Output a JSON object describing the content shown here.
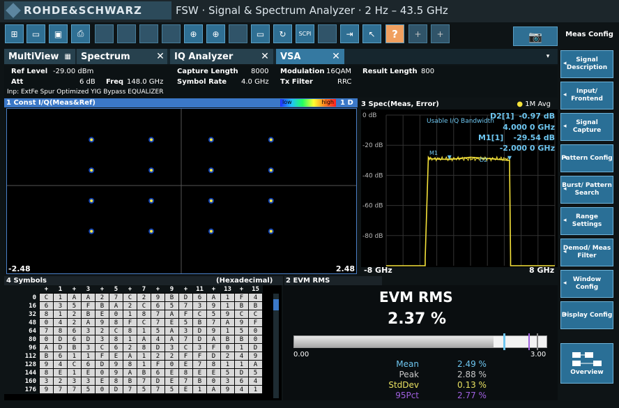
{
  "app": {
    "logo_text": "ROHDE&SCHWARZ",
    "title": "FSW · Signal & Spectrum Analyzer · 2 Hz – 43.5 GHz"
  },
  "toolbar": {
    "scpi_label": "SCPI",
    "help_label": "?",
    "camera_icon": "camera-icon"
  },
  "side_panel": {
    "header": "Meas Config",
    "buttons": [
      {
        "label": "Signal Description"
      },
      {
        "label": "Input/ Frontend"
      },
      {
        "label": "Signal Capture"
      },
      {
        "label": "Pattern Config"
      },
      {
        "label": "Burst/ Pattern Search"
      },
      {
        "label": "Range Settings"
      },
      {
        "label": "Demod/ Meas Filter"
      },
      {
        "label": "Window Config"
      },
      {
        "label": "Display Config"
      },
      {
        "label": "Overview"
      }
    ]
  },
  "tabs": [
    {
      "label": "MultiView"
    },
    {
      "label": "Spectrum"
    },
    {
      "label": "IQ Analyzer"
    },
    {
      "label": "VSA"
    }
  ],
  "info": {
    "ref_level_label": "Ref Level",
    "ref_level_value": "-29.00 dBm",
    "att_label": "Att",
    "att_value": "6 dB",
    "freq_label": "Freq",
    "freq_value": "148.0 GHz",
    "capture_length_label": "Capture Length",
    "capture_length_value": "8000",
    "symbol_rate_label": "Symbol Rate",
    "symbol_rate_value": "4.0 GHz",
    "modulation_label": "Modulation",
    "modulation_value": "16QAM",
    "tx_filter_label": "Tx Filter",
    "tx_filter_value": "RRC",
    "result_length_label": "Result Length",
    "result_length_value": "800",
    "inp_line": "Inp: ExtFe Spur Optimized YIG Bypass EQUALIZER"
  },
  "pane1": {
    "title": "1 Const I/Q(Meas&Ref)",
    "legend_low": "low",
    "legend_high": "high",
    "trace_tag": "1 D",
    "x_min_label": "-2.48",
    "x_max_label": "2.48"
  },
  "pane3": {
    "title": "3 Spec(Meas, Error)",
    "avg_label": "1M Avg",
    "marker_d2_label": "D2[1]",
    "marker_d2_level": "-0.97 dB",
    "marker_d2_freq": "4.000 0 GHz",
    "marker_m1_label": "M1[1]",
    "marker_m1_level": "-29.54 dB",
    "marker_m1_freq": "-2.000 0 GHz",
    "bandwidth_note": "Usable I/Q Bandwidth",
    "marker_m1_tag": "M1",
    "marker_d2_tag": "D2",
    "x_start_label": "-8 GHz",
    "x_stop_label": "8 GHz",
    "y_ticks": [
      "0 dB",
      "-20 dB",
      "-40 dB",
      "-60 dB",
      "-80 dB"
    ]
  },
  "pane4": {
    "title": "4 Symbols",
    "format": "(Hexadecimal)",
    "col_header": [
      "+",
      "1",
      "+",
      "3",
      "+",
      "5",
      "+",
      "7",
      "+",
      "9",
      "+",
      "11",
      "+",
      "13",
      "+",
      "15"
    ],
    "rows": [
      {
        "offset": "0",
        "cells": [
          "C",
          "1",
          "A",
          "A",
          "2",
          "7",
          "C",
          "2",
          "9",
          "B",
          "D",
          "6",
          "A",
          "1",
          "F",
          "4"
        ]
      },
      {
        "offset": "16",
        "cells": [
          "6",
          "3",
          "5",
          "F",
          "B",
          "A",
          "2",
          "C",
          "6",
          "5",
          "7",
          "3",
          "9",
          "1",
          "B",
          "B"
        ]
      },
      {
        "offset": "32",
        "cells": [
          "8",
          "1",
          "2",
          "B",
          "E",
          "0",
          "1",
          "8",
          "7",
          "A",
          "F",
          "C",
          "5",
          "9",
          "C",
          "C"
        ]
      },
      {
        "offset": "48",
        "cells": [
          "0",
          "4",
          "2",
          "A",
          "9",
          "8",
          "F",
          "C",
          "7",
          "E",
          "5",
          "B",
          "7",
          "A",
          "9",
          "F"
        ]
      },
      {
        "offset": "64",
        "cells": [
          "7",
          "8",
          "6",
          "3",
          "2",
          "C",
          "8",
          "1",
          "5",
          "A",
          "3",
          "D",
          "9",
          "1",
          "5",
          "0"
        ]
      },
      {
        "offset": "80",
        "cells": [
          "0",
          "D",
          "6",
          "D",
          "3",
          "8",
          "1",
          "A",
          "4",
          "A",
          "7",
          "D",
          "A",
          "B",
          "B",
          "0"
        ]
      },
      {
        "offset": "96",
        "cells": [
          "A",
          "D",
          "B",
          "3",
          "C",
          "6",
          "2",
          "8",
          "D",
          "3",
          "C",
          "3",
          "F",
          "0",
          "1",
          "D"
        ]
      },
      {
        "offset": "112",
        "cells": [
          "B",
          "6",
          "1",
          "1",
          "F",
          "E",
          "A",
          "1",
          "2",
          "2",
          "F",
          "F",
          "D",
          "2",
          "4",
          "9"
        ]
      },
      {
        "offset": "128",
        "cells": [
          "9",
          "4",
          "C",
          "6",
          "D",
          "9",
          "8",
          "1",
          "F",
          "0",
          "E",
          "7",
          "8",
          "1",
          "1",
          "A"
        ]
      },
      {
        "offset": "144",
        "cells": [
          "8",
          "E",
          "1",
          "E",
          "0",
          "9",
          "A",
          "B",
          "6",
          "E",
          "8",
          "E",
          "E",
          "5",
          "D",
          "5"
        ]
      },
      {
        "offset": "160",
        "cells": [
          "3",
          "2",
          "3",
          "3",
          "E",
          "8",
          "B",
          "7",
          "D",
          "E",
          "7",
          "B",
          "0",
          "3",
          "6",
          "4"
        ]
      },
      {
        "offset": "176",
        "cells": [
          "9",
          "7",
          "7",
          "5",
          "0",
          "D",
          "7",
          "5",
          "7",
          "5",
          "E",
          "1",
          "A",
          "9",
          "4",
          "1"
        ]
      }
    ]
  },
  "pane2": {
    "title": "2 EVM RMS",
    "big_label": "EVM RMS",
    "big_value": "2.37 %",
    "scale_min": "0.00",
    "scale_max": "3.00",
    "bar_fraction": 0.79,
    "stats": [
      {
        "label": "Mean",
        "value": "2.49 %",
        "color": "#6ec6f0"
      },
      {
        "label": "Peak",
        "value": "2.88 %",
        "color": "#c8c8c8"
      },
      {
        "label": "StdDev",
        "value": "0.13 %",
        "color": "#e8e060"
      },
      {
        "label": "95Pct",
        "value": "2.77 %",
        "color": "#a060e0"
      }
    ]
  },
  "colors": {
    "accent": "#3579a1",
    "side_button": "#2a6f96",
    "trace_yellow": "#f5e23a",
    "active_pane": "#3b78c8"
  },
  "chart_data": [
    {
      "type": "scatter",
      "title": "1 Const I/Q(Meas&Ref)",
      "xlim": [
        -2.48,
        2.48
      ],
      "series": [
        {
          "x": [
            -1.5,
            -0.5,
            0.5,
            1.5,
            -1.5,
            -0.5,
            0.5,
            1.5,
            -1.5,
            -0.5,
            0.5,
            1.5,
            -1.5,
            -0.5,
            0.5,
            1.5
          ],
          "y": [
            1.5,
            1.5,
            1.5,
            1.5,
            0.5,
            0.5,
            0.5,
            0.5,
            -0.5,
            -0.5,
            -0.5,
            -0.5,
            -1.5,
            -1.5,
            -1.5,
            -1.5
          ]
        }
      ]
    },
    {
      "type": "line",
      "title": "3 Spec(Meas, Error)",
      "xlabel": "",
      "ylabel": "",
      "xlim": [
        -8,
        8
      ],
      "ylim": [
        -100,
        0
      ],
      "x": [
        -8,
        -4.3,
        -4.3,
        -4.0,
        -3.9,
        -2.0,
        0,
        2.0,
        3.6,
        3.7,
        3.8,
        3.8,
        8
      ],
      "values": [
        -100,
        -100,
        -95,
        -28,
        -29,
        -29.5,
        -28,
        -29,
        -30,
        -30,
        -95,
        -100,
        -100
      ]
    }
  ]
}
